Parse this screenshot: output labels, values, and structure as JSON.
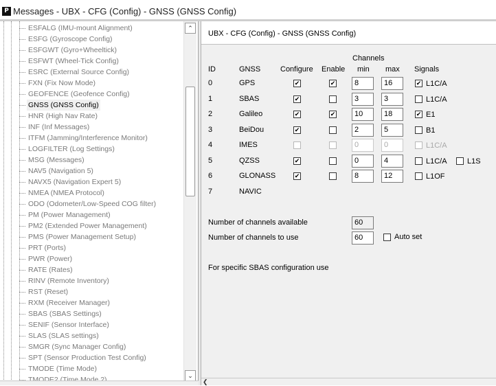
{
  "window": {
    "app_icon": "P",
    "title": "Messages - UBX - CFG (Config) - GNSS (GNSS Config)"
  },
  "tree": {
    "items": [
      {
        "label": "ESFALG (IMU-mount Alignment)"
      },
      {
        "label": "ESFG (Gyroscope Config)"
      },
      {
        "label": "ESFGWT (Gyro+Wheeltick)"
      },
      {
        "label": "ESFWT (Wheel-Tick Config)"
      },
      {
        "label": "ESRC (External Source Config)"
      },
      {
        "label": "FXN (Fix Now Mode)"
      },
      {
        "label": "GEOFENCE (Geofence Config)"
      },
      {
        "label": "GNSS (GNSS Config)",
        "selected": true
      },
      {
        "label": "HNR (High Nav Rate)"
      },
      {
        "label": "INF (Inf Messages)"
      },
      {
        "label": "ITFM (Jamming/Interference Monitor)"
      },
      {
        "label": "LOGFILTER (Log Settings)"
      },
      {
        "label": "MSG (Messages)"
      },
      {
        "label": "NAV5 (Navigation 5)"
      },
      {
        "label": "NAVX5 (Navigation Expert 5)"
      },
      {
        "label": "NMEA (NMEA Protocol)"
      },
      {
        "label": "ODO (Odometer/Low-Speed COG filter)"
      },
      {
        "label": "PM (Power Management)"
      },
      {
        "label": "PM2 (Extended Power Management)"
      },
      {
        "label": "PMS (Power Management Setup)"
      },
      {
        "label": "PRT (Ports)"
      },
      {
        "label": "PWR (Power)"
      },
      {
        "label": "RATE (Rates)"
      },
      {
        "label": "RINV (Remote Inventory)"
      },
      {
        "label": "RST (Reset)"
      },
      {
        "label": "RXM (Receiver Manager)"
      },
      {
        "label": "SBAS (SBAS Settings)"
      },
      {
        "label": "SENIF (Sensor Interface)"
      },
      {
        "label": "SLAS (SLAS settings)"
      },
      {
        "label": "SMGR (Sync Manager Config)"
      },
      {
        "label": "SPT (Sensor Production Test Config)"
      },
      {
        "label": "TMODE (Time Mode)"
      },
      {
        "label": "TMODE2 (Time Mode 2)"
      }
    ],
    "scroll_up_icon": "chevron-up-icon",
    "scroll_down_icon": "chevron-down-icon"
  },
  "panel": {
    "header": "UBX - CFG (Config) - GNSS (GNSS Config)",
    "columns": {
      "id": "ID",
      "gnss": "GNSS",
      "configure": "Configure",
      "enable": "Enable",
      "channels": "Channels",
      "min": "min",
      "max": "max",
      "signals": "Signals"
    },
    "rows": [
      {
        "id": "0",
        "gnss": "GPS",
        "configure": true,
        "enable": true,
        "enable_disabled": false,
        "min": "8",
        "max": "16",
        "inputs_disabled": false,
        "signals": [
          {
            "label": "L1C/A",
            "checked": true,
            "disabled": false
          }
        ]
      },
      {
        "id": "1",
        "gnss": "SBAS",
        "configure": true,
        "enable": false,
        "enable_disabled": false,
        "min": "3",
        "max": "3",
        "inputs_disabled": false,
        "signals": [
          {
            "label": "L1C/A",
            "checked": false,
            "disabled": false
          }
        ]
      },
      {
        "id": "2",
        "gnss": "Galileo",
        "configure": true,
        "enable": true,
        "enable_disabled": false,
        "min": "10",
        "max": "18",
        "inputs_disabled": false,
        "signals": [
          {
            "label": "E1",
            "checked": true,
            "disabled": false
          }
        ]
      },
      {
        "id": "3",
        "gnss": "BeiDou",
        "configure": true,
        "enable": false,
        "enable_disabled": false,
        "min": "2",
        "max": "5",
        "inputs_disabled": false,
        "signals": [
          {
            "label": "B1",
            "checked": false,
            "disabled": false
          }
        ]
      },
      {
        "id": "4",
        "gnss": "IMES",
        "configure": false,
        "configure_disabled": true,
        "enable": false,
        "enable_disabled": true,
        "min": "0",
        "max": "0",
        "inputs_disabled": true,
        "signals": [
          {
            "label": "L1C/A",
            "checked": false,
            "disabled": true
          }
        ]
      },
      {
        "id": "5",
        "gnss": "QZSS",
        "configure": true,
        "enable": false,
        "enable_disabled": false,
        "min": "0",
        "max": "4",
        "inputs_disabled": false,
        "signals": [
          {
            "label": "L1C/A",
            "checked": false,
            "disabled": false
          },
          {
            "label": "L1S",
            "checked": false,
            "disabled": false
          }
        ]
      },
      {
        "id": "6",
        "gnss": "GLONASS",
        "configure": true,
        "enable": false,
        "enable_disabled": false,
        "min": "8",
        "max": "12",
        "inputs_disabled": false,
        "signals": [
          {
            "label": "L1OF",
            "checked": false,
            "disabled": false
          }
        ]
      },
      {
        "id": "7",
        "gnss": "NAVIC",
        "no_controls": true
      }
    ],
    "channels_available_label": "Number of channels available",
    "channels_available_value": "60",
    "channels_to_use_label": "Number of channels to use",
    "channels_to_use_value": "60",
    "auto_set_label": "Auto set",
    "auto_set_checked": false,
    "sbas_note": "For specific SBAS configuration use"
  }
}
